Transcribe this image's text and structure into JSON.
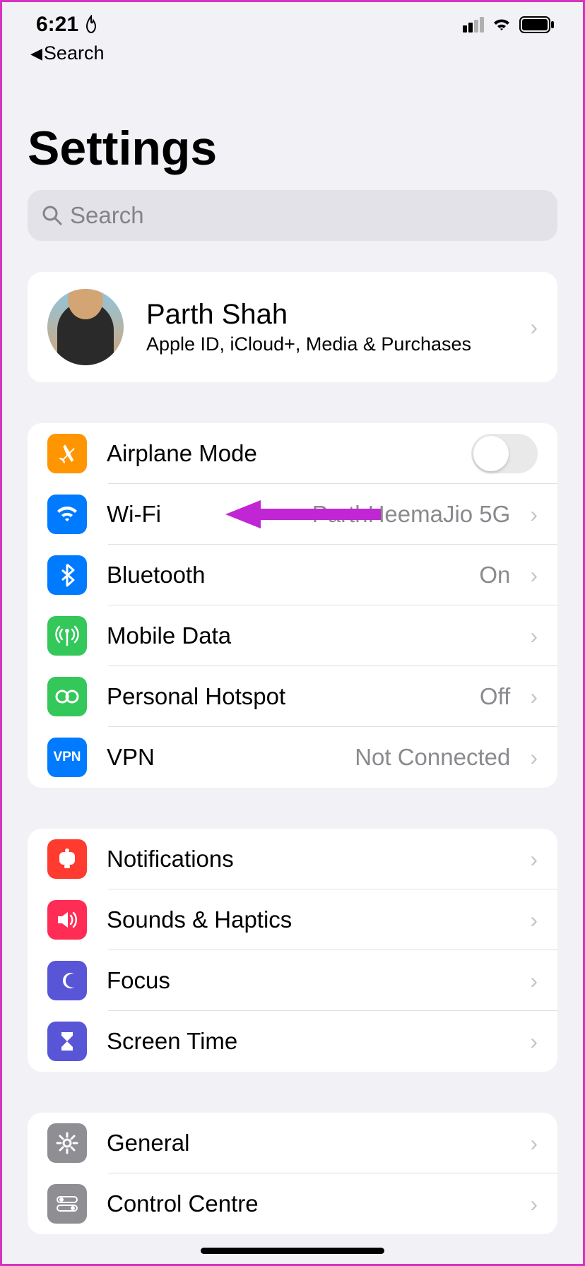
{
  "statusBar": {
    "time": "6:21"
  },
  "backNav": "Search",
  "pageTitle": "Settings",
  "search": {
    "placeholder": "Search"
  },
  "profile": {
    "name": "Parth Shah",
    "subtitle": "Apple ID, iCloud+, Media & Purchases"
  },
  "group1": {
    "airplane": {
      "label": "Airplane Mode"
    },
    "wifi": {
      "label": "Wi-Fi",
      "value": "ParthHeemaJio 5G"
    },
    "bluetooth": {
      "label": "Bluetooth",
      "value": "On"
    },
    "mobileData": {
      "label": "Mobile Data"
    },
    "hotspot": {
      "label": "Personal Hotspot",
      "value": "Off"
    },
    "vpn": {
      "label": "VPN",
      "value": "Not Connected",
      "iconText": "VPN"
    }
  },
  "group2": {
    "notifications": {
      "label": "Notifications"
    },
    "sounds": {
      "label": "Sounds & Haptics"
    },
    "focus": {
      "label": "Focus"
    },
    "screenTime": {
      "label": "Screen Time"
    }
  },
  "group3": {
    "general": {
      "label": "General"
    },
    "controlCentre": {
      "label": "Control Centre"
    }
  }
}
